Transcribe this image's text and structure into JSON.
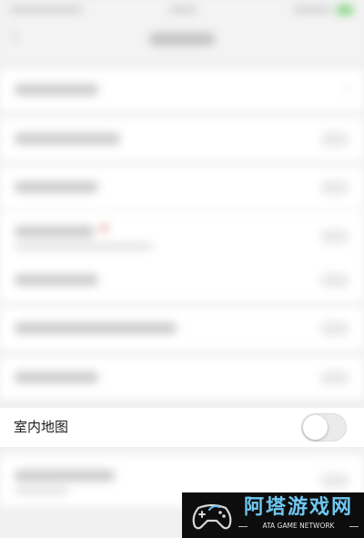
{
  "settings": {
    "indoor_map": {
      "label": "室内地图",
      "enabled": false
    }
  },
  "watermark": {
    "title": "阿塔游戏网",
    "subtitle": "ATA GAME NETWORK"
  },
  "colors": {
    "row_background": "#ffffff",
    "page_background": "#f1f1f1",
    "toggle_off_track": "#ebebeb",
    "watermark_background": "#0d0d0d",
    "watermark_accent": "#6fc8f2"
  }
}
